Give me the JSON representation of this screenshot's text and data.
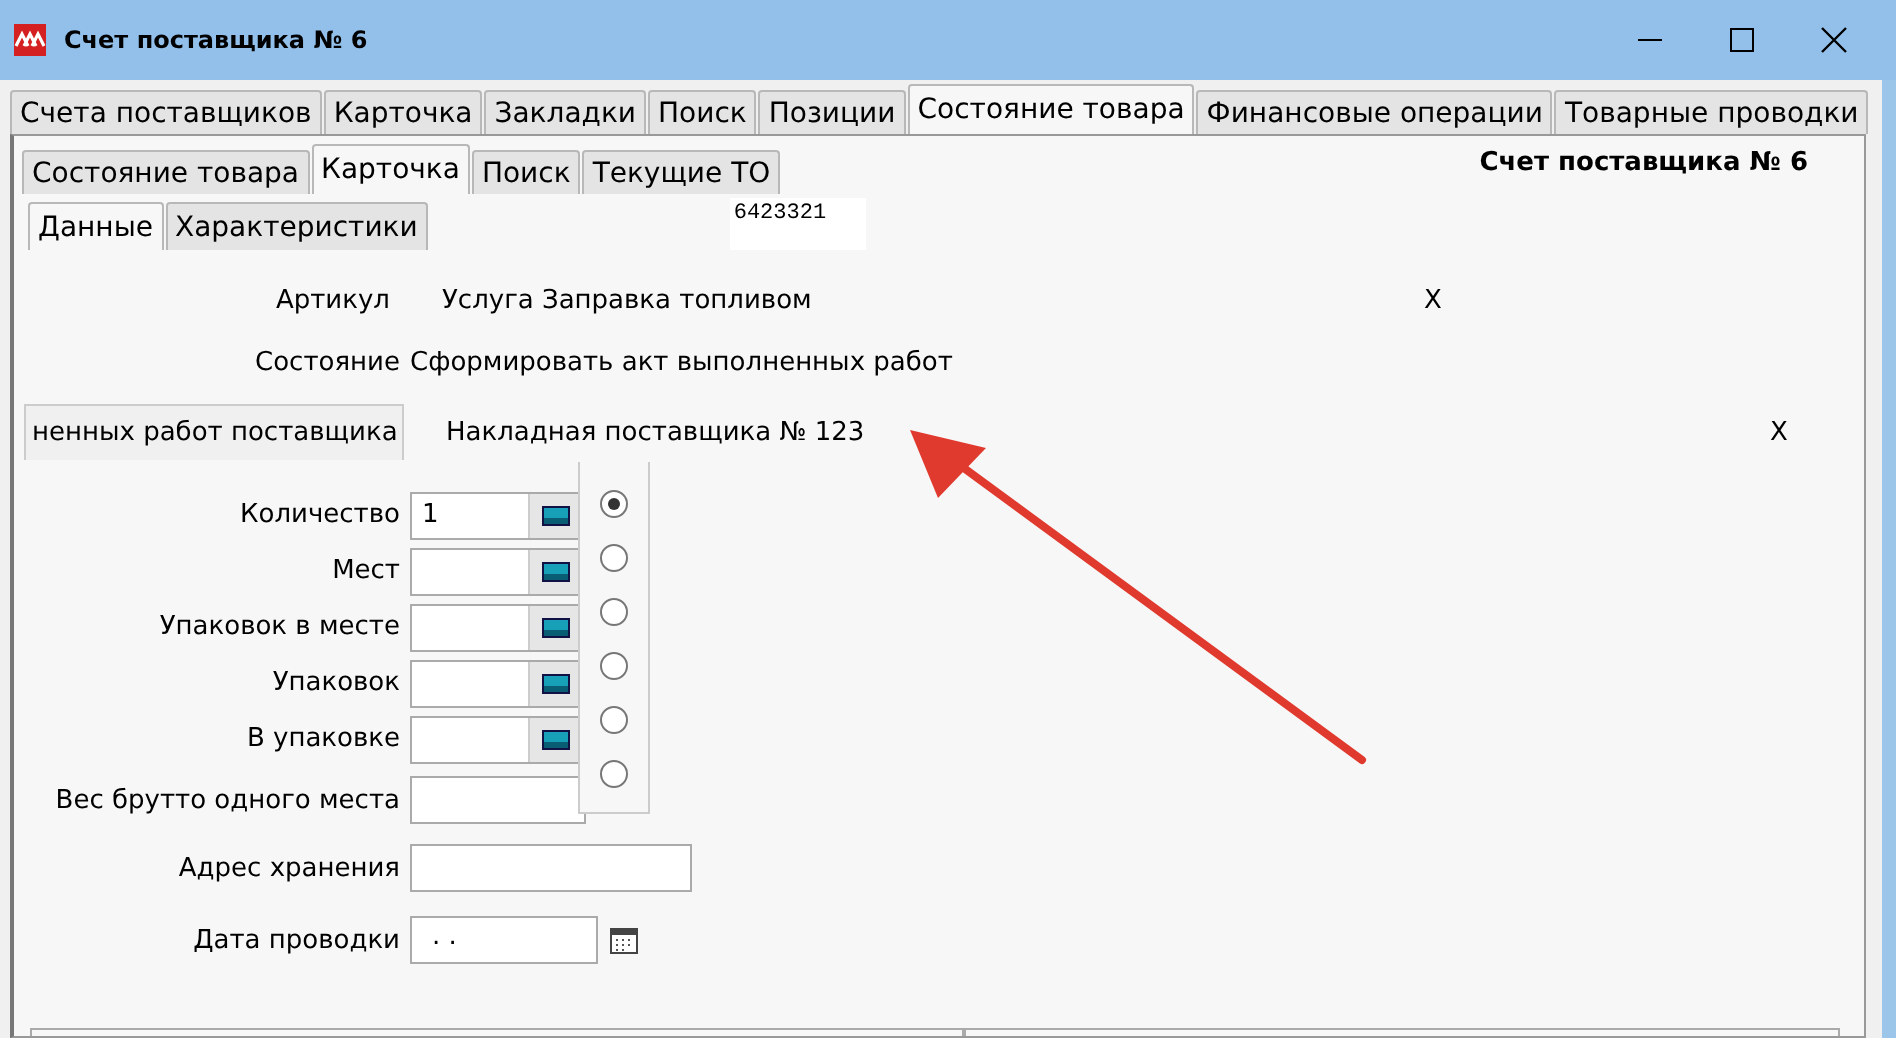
{
  "window": {
    "title": "Счет поставщика № 6"
  },
  "tabs": [
    {
      "label": "Счета поставщиков",
      "selected": false
    },
    {
      "label": "Карточка",
      "selected": false
    },
    {
      "label": "Закладки",
      "selected": false
    },
    {
      "label": "Поиск",
      "selected": false
    },
    {
      "label": "Позиции",
      "selected": false
    },
    {
      "label": "Состояние товара",
      "selected": true
    },
    {
      "label": "Финансовые операции",
      "selected": false
    },
    {
      "label": "Товарные проводки",
      "selected": false
    }
  ],
  "doc_title": "Счет поставщика № 6",
  "inner_tabs": [
    {
      "label": "Состояние товара",
      "selected": false
    },
    {
      "label": "Карточка",
      "selected": true
    },
    {
      "label": "Поиск",
      "selected": false
    },
    {
      "label": "Текущие ТО",
      "selected": false
    }
  ],
  "sub_tabs": [
    {
      "label": "Данные",
      "selected": true
    },
    {
      "label": "Характеристики",
      "selected": false
    }
  ],
  "code": "6423321",
  "article": {
    "label": "Артикул",
    "value": "Услуга Заправка топливом",
    "clear": "X"
  },
  "state": {
    "label": "Состояние",
    "value": "Сформировать акт выполненных работ"
  },
  "document": {
    "button": "ненных работ поставщика",
    "value": "Накладная поставщика № 123",
    "clear": "X"
  },
  "quantity_fields": [
    {
      "label": "Количество",
      "value": "1"
    },
    {
      "label": "Мест"
    },
    {
      "label": "Упаковок в месте"
    },
    {
      "label": "Упаковок"
    },
    {
      "label": "В упаковке"
    }
  ],
  "radios": [
    {
      "selected": true
    },
    {
      "selected": false
    },
    {
      "selected": false
    },
    {
      "selected": false
    },
    {
      "selected": false
    },
    {
      "selected": false
    }
  ],
  "fields": [
    {
      "label": "Вес брутто одного места",
      "kind": "short"
    },
    {
      "label": "Адрес хранения",
      "kind": "long"
    },
    {
      "label": "Дата проводки",
      "value": ". .",
      "kind": "date"
    }
  ]
}
